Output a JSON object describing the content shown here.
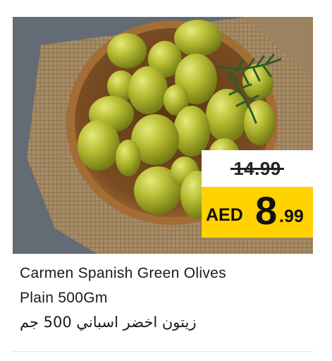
{
  "product": {
    "name_line1": "Carmen Spanish Green Olives",
    "name_line2": "Plain 500Gm",
    "name_arabic": "زيتون اخضر اسباني 500 جم"
  },
  "price": {
    "old": "14.99",
    "currency": "AED",
    "new_integer": "8",
    "new_decimal": ".99"
  },
  "image": {
    "subject": "bowl of green olives on burlap",
    "icon": "olives-photo"
  },
  "colors": {
    "price_tag_yellow": "#ffd200",
    "olive_green": "#a8b02c",
    "bowl_brown": "#8a5a2b",
    "background_slate": "#5f6770",
    "burlap": "#a88d68"
  }
}
